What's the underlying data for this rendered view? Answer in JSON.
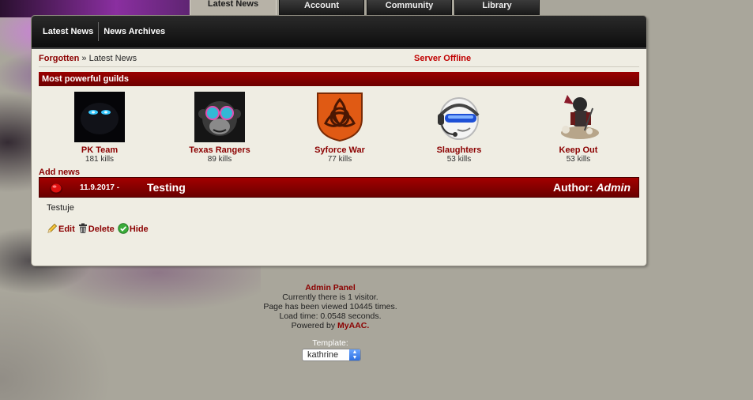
{
  "tabs": [
    {
      "label": "Latest News",
      "active": true
    },
    {
      "label": "Account",
      "active": false
    },
    {
      "label": "Community",
      "active": false
    },
    {
      "label": "Library",
      "active": false
    }
  ],
  "subnav": {
    "items": [
      "Latest News",
      "News Archives"
    ]
  },
  "breadcrumb": {
    "root": "Forgotten",
    "separator": "»",
    "current": "Latest News"
  },
  "server_status": "Server Offline",
  "guilds_section": {
    "title": "Most powerful guilds",
    "guilds": [
      {
        "name": "PK Team",
        "kills": "181 kills",
        "logo": "dark-creature-icon"
      },
      {
        "name": "Texas Rangers",
        "kills": "89 kills",
        "logo": "monkey-with-glasses-icon"
      },
      {
        "name": "Syforce War",
        "kills": "77 kills",
        "logo": "celtic-knot-shield-icon"
      },
      {
        "name": "Slaughters",
        "kills": "53 kills",
        "logo": "headset-mascot-icon"
      },
      {
        "name": "Keep Out",
        "kills": "53 kills",
        "logo": "skeleton-warrior-icon"
      }
    ]
  },
  "news": {
    "add_label": "Add news",
    "date": "11.9.2017 -",
    "title": "Testing",
    "author_prefix": "Author:",
    "author": "Admin",
    "body": "Testuje",
    "actions": {
      "edit": "Edit",
      "delete": "Delete",
      "hide": "Hide"
    }
  },
  "footer": {
    "admin_panel": "Admin Panel",
    "visitors": "Currently there is 1 visitor.",
    "views": "Page has been viewed 10445 times.",
    "load_time": "Load time: 0.0548 seconds.",
    "powered_prefix": "Powered by",
    "powered_brand": "MyAAC.",
    "template_label": "Template:",
    "template_value": "kathrine"
  },
  "colors": {
    "accent": "#8b0000",
    "bar": "#8f0000",
    "offline": "#c00000",
    "panel": "#efede3",
    "page_bg": "#a9a69b"
  }
}
